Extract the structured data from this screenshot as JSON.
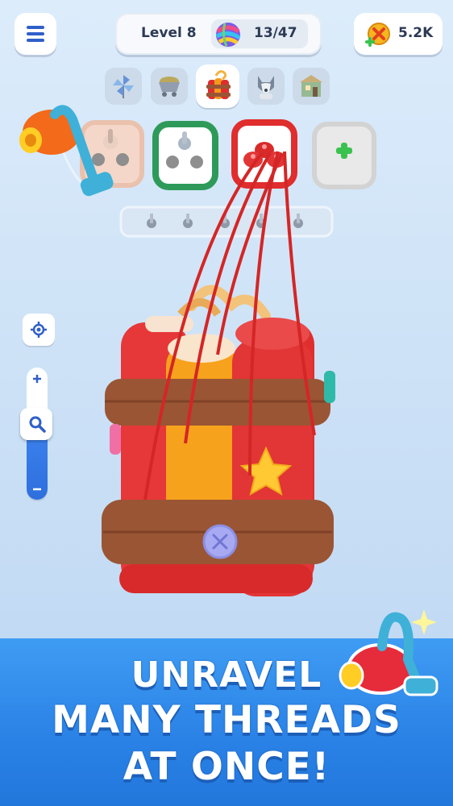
{
  "header": {
    "level_label": "Level 8",
    "progress_label": "13/47",
    "progress": {
      "current": 13,
      "total": 47
    },
    "coins_label": "5.2K",
    "menu_icon": "hamburger-icon",
    "yarn_icon": "yarn-ball-icon",
    "coin_icon": "coin-plus-icon"
  },
  "collection_tabs": [
    {
      "icon": "pinwheel-icon",
      "active": false
    },
    {
      "icon": "mine-cart-icon",
      "active": false
    },
    {
      "icon": "dynamite-icon",
      "active": true
    },
    {
      "icon": "husky-dog-icon",
      "active": false
    },
    {
      "icon": "house-icon",
      "active": false
    }
  ],
  "spool_boxes": [
    {
      "color": "#f4d7c8",
      "border": "#e9c1ad",
      "pegs": 3,
      "filled": 1
    },
    {
      "color": "#ffffff",
      "border": "#2e9a5a",
      "pegs": 3,
      "filled": 1
    },
    {
      "color": "#ffffff",
      "border": "#e02d2d",
      "pegs": 3,
      "filled": 3
    },
    {
      "color": "#e9e9e9",
      "border": "#d3d3d3",
      "locked": true,
      "icon": "add-plus-icon"
    }
  ],
  "holding_tray": {
    "slots": 5
  },
  "tools": {
    "locate_icon": "target-locate-icon",
    "zoom_in_icon": "plus-icon",
    "zoom_out_icon": "minus-icon",
    "zoom_handle_icon": "magnifier-icon",
    "zoom_level": 0.67
  },
  "banner": {
    "line1": "UNRAVEL",
    "line2": "MANY THREADS",
    "line3": "AT ONCE!"
  },
  "colors": {
    "accent_blue": "#2a82e6",
    "thread_red": "#e02d2d",
    "thread_orange": "#f7a21c",
    "strap_brown": "#9a5534"
  }
}
